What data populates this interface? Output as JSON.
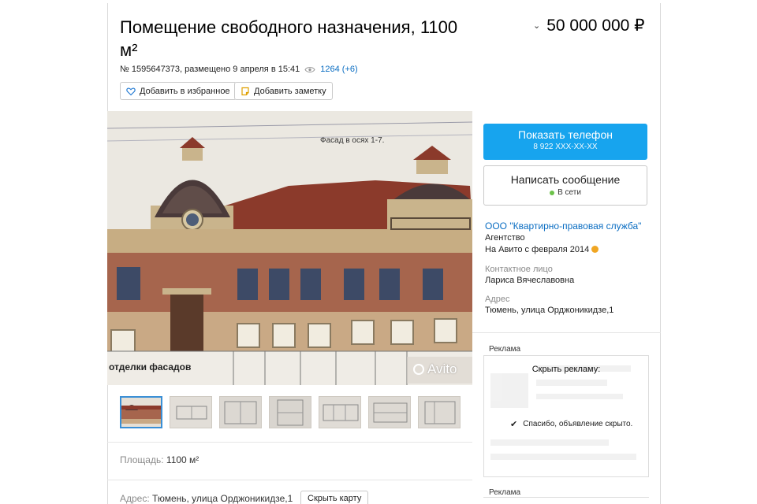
{
  "listing": {
    "title": "Помещение свободного назначения, 1100 м²",
    "price": "50 000 000 ₽",
    "meta_text": "№ 1595647373, размещено 9 апреля в 15:41",
    "views": "1264 (+6)",
    "favorite_label": "Добавить в избранное",
    "note_label": "Добавить заметку"
  },
  "photo": {
    "facade_caption": "Фасад в осях 1-7.",
    "bottom_caption": "отделки фасадов",
    "watermark": "Avito",
    "thumb_count": 7
  },
  "params": {
    "area_label": "Площадь:",
    "area_value": "1100 м²",
    "address_label": "Адрес:",
    "address_value": "Тюмень, улица Орджоникидзе,1",
    "map_button": "Скрыть карту"
  },
  "contact": {
    "phone_button": "Показать телефон",
    "phone_masked": "8 922 XXX-XX-XX",
    "message_button": "Написать сообщение",
    "online_status": "В сети",
    "company": "ООО \"Квартирно-правовая служба\"",
    "company_type": "Агентство",
    "since": "На Авито с февраля 2014",
    "contact_label": "Контактное лицо",
    "contact_name": "Лариса Вячеславовна",
    "address_label": "Адрес",
    "address_value": "Тюмень, улица Орджоникидзе,1"
  },
  "ads": {
    "label": "Реклама",
    "hide_title": "Скрыть рекламу:",
    "hidden_message": "Спасибо, объявление скрыто.",
    "label2": "Реклама"
  },
  "colors": {
    "accent_blue": "#17a4ee",
    "link_blue": "#0a6dc2",
    "online_green": "#6cc24a",
    "since_badge": "#f0a623"
  }
}
